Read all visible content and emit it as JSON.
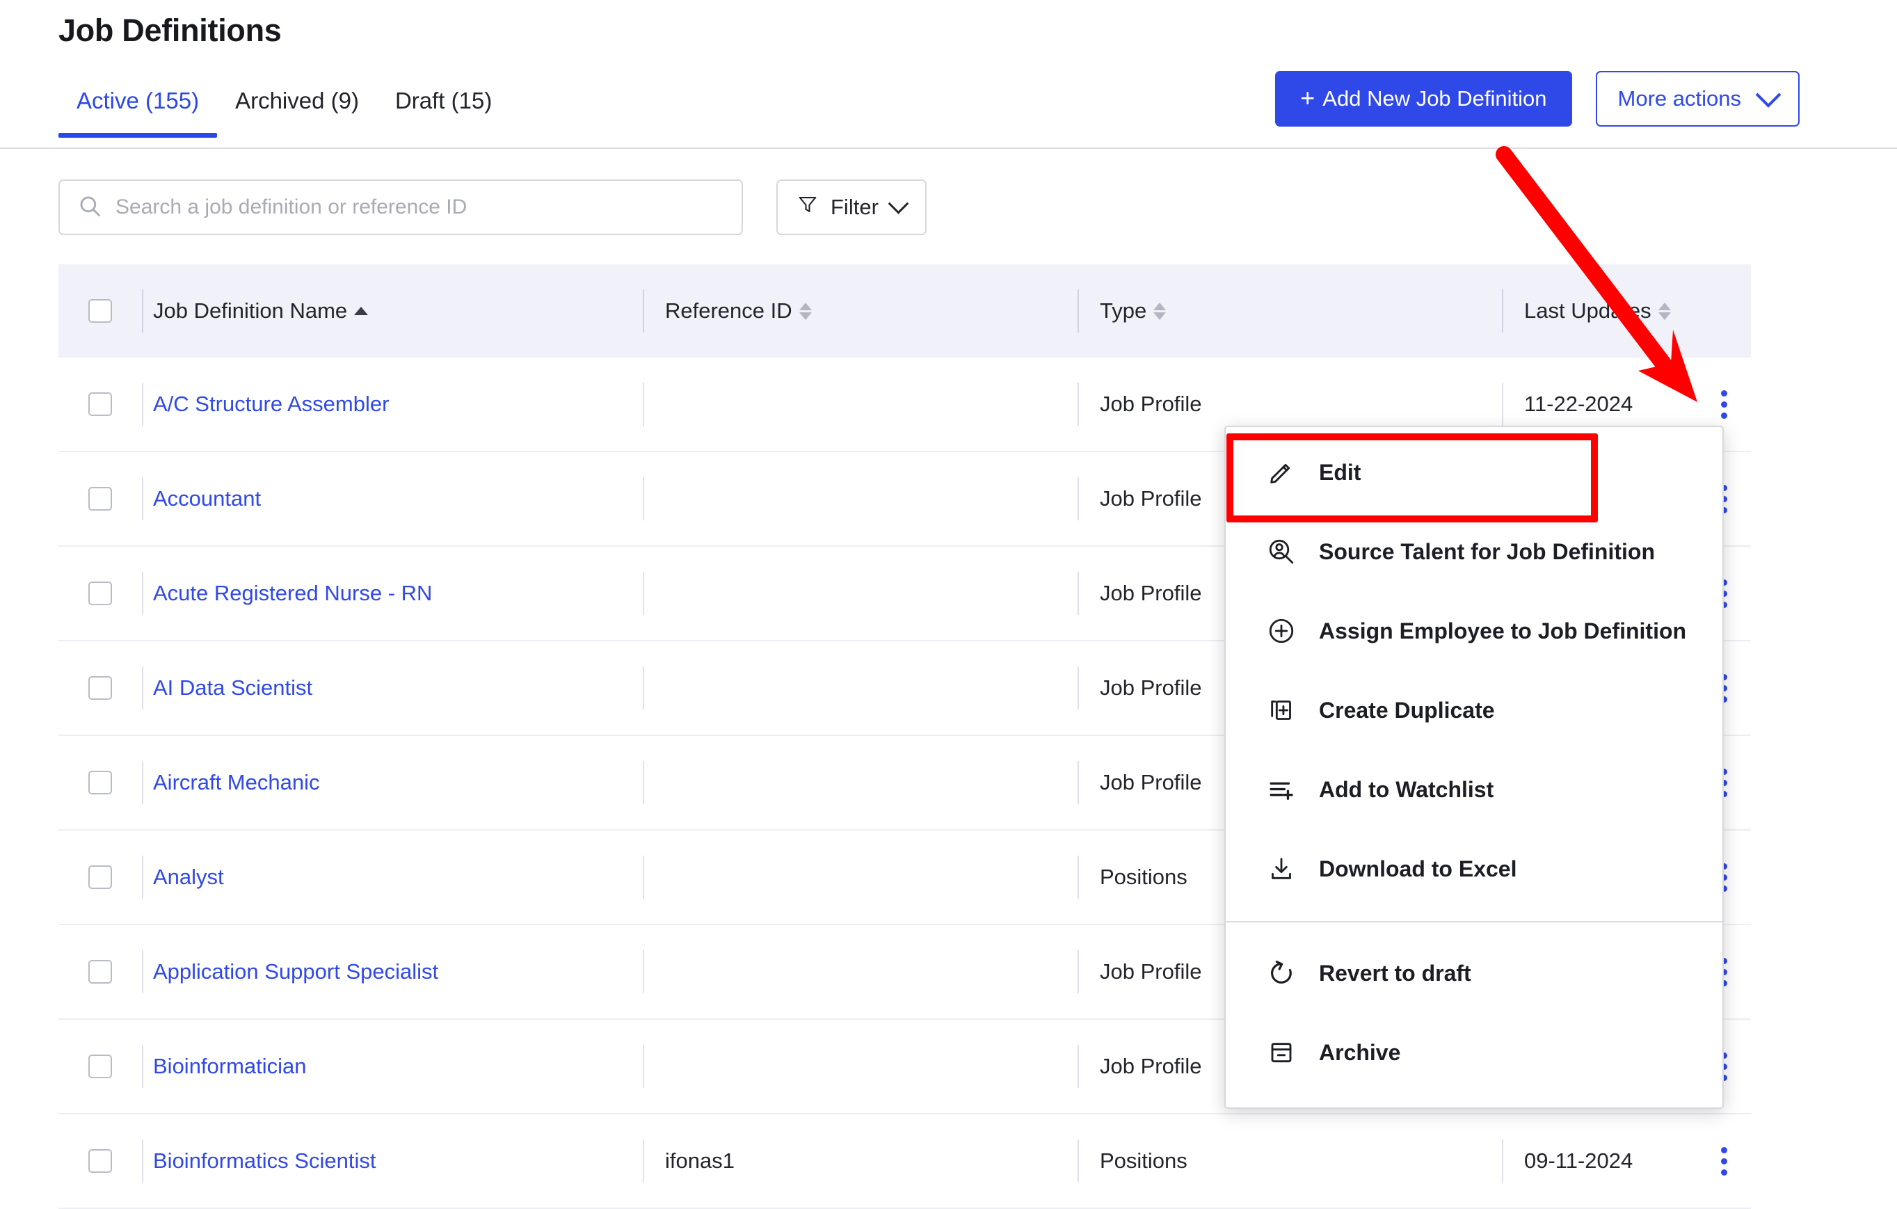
{
  "header": {
    "title": "Job Definitions",
    "tabs": [
      {
        "label": "Active (155)",
        "active": true
      },
      {
        "label": "Archived (9)",
        "active": false
      },
      {
        "label": "Draft (15)",
        "active": false
      }
    ],
    "add_button_plus": "+",
    "add_button_label": "Add New Job Definition",
    "more_actions_label": "More actions"
  },
  "toolbar": {
    "search_placeholder": "Search a job definition or reference ID",
    "search_value": "",
    "filter_label": "Filter"
  },
  "table": {
    "columns": [
      {
        "key": "name",
        "label": "Job Definition Name",
        "sort": "asc"
      },
      {
        "key": "reference_id",
        "label": "Reference ID",
        "sort": "none"
      },
      {
        "key": "type",
        "label": "Type",
        "sort": "none"
      },
      {
        "key": "last_updates",
        "label": "Last Updates",
        "sort": "none"
      }
    ],
    "rows": [
      {
        "name": "A/C Structure Assembler",
        "reference_id": "",
        "type": "Job Profile",
        "last_updates": "11-22-2024"
      },
      {
        "name": "Accountant",
        "reference_id": "",
        "type": "Job Profile",
        "last_updates": ""
      },
      {
        "name": "Acute Registered Nurse - RN",
        "reference_id": "",
        "type": "Job Profile",
        "last_updates": ""
      },
      {
        "name": "AI Data Scientist",
        "reference_id": "",
        "type": "Job Profile",
        "last_updates": ""
      },
      {
        "name": "Aircraft Mechanic",
        "reference_id": "",
        "type": "Job Profile",
        "last_updates": ""
      },
      {
        "name": "Analyst",
        "reference_id": "",
        "type": "Positions",
        "last_updates": ""
      },
      {
        "name": "Application Support Specialist",
        "reference_id": "",
        "type": "Job Profile",
        "last_updates": ""
      },
      {
        "name": "Bioinformatician",
        "reference_id": "",
        "type": "Job Profile",
        "last_updates": ""
      },
      {
        "name": "Bioinformatics Scientist",
        "reference_id": "ifonas1",
        "type": "Positions",
        "last_updates": "09-11-2024"
      }
    ]
  },
  "action_menu": {
    "groups": [
      {
        "items": [
          {
            "label": "Edit",
            "icon": "pencil-icon",
            "highlighted": true
          },
          {
            "label": "Source Talent for Job Definition",
            "icon": "person-search-icon",
            "highlighted": false
          },
          {
            "label": "Assign Employee to Job Definition",
            "icon": "plus-circle-icon",
            "highlighted": false
          },
          {
            "label": "Create Duplicate",
            "icon": "duplicate-icon",
            "highlighted": false
          },
          {
            "label": "Add to Watchlist",
            "icon": "list-add-icon",
            "highlighted": false
          },
          {
            "label": "Download to Excel",
            "icon": "download-icon",
            "highlighted": false
          }
        ]
      },
      {
        "items": [
          {
            "label": "Revert to draft",
            "icon": "revert-icon",
            "highlighted": false
          },
          {
            "label": "Archive",
            "icon": "archive-icon",
            "highlighted": false
          }
        ]
      }
    ]
  },
  "annotations": {
    "arrow_color": "#fe0000",
    "highlight_color": "#fe0000"
  },
  "colors": {
    "accent_blue": "#2f48e8",
    "header_row_bg": "#f0f1f9",
    "text_dark": "#23242b",
    "placeholder_grey": "#a9abb4"
  }
}
